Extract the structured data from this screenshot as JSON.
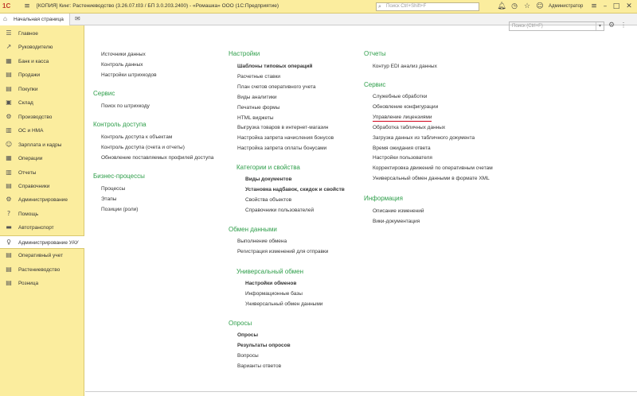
{
  "titlebar": {
    "title": "[КОПИЯ] Кинг: Растениеводство (3.26.07.t03 / БП 3.0.203.2400) - «Ромашка» ООО  (1С:Предприятие)",
    "search_placeholder": "Поиск Ctrl+Shift+F",
    "user": "Администратор",
    "logo": "1С"
  },
  "tabs": {
    "home_label": "Начальная страница"
  },
  "sidebar": {
    "items": [
      {
        "label": "Главное",
        "icon": "☰"
      },
      {
        "label": "Руководителю",
        "icon": "↗"
      },
      {
        "label": "Банк и касса",
        "icon": "▦"
      },
      {
        "label": "Продажи",
        "icon": "▤"
      },
      {
        "label": "Покупки",
        "icon": "▤"
      },
      {
        "label": "Склад",
        "icon": "▣"
      },
      {
        "label": "Производство",
        "icon": "⚙"
      },
      {
        "label": "ОС и НМА",
        "icon": "▥"
      },
      {
        "label": "Зарплата и кадры",
        "icon": "☺"
      },
      {
        "label": "Операции",
        "icon": "▦"
      },
      {
        "label": "Отчеты",
        "icon": "▥"
      },
      {
        "label": "Справочники",
        "icon": "▤"
      },
      {
        "label": "Администрирование",
        "icon": "⚙"
      },
      {
        "label": "Помощь",
        "icon": "?"
      },
      {
        "label": "Автотранспорт",
        "icon": "▬"
      },
      {
        "label": "Администрирование УАУ",
        "icon": "♀"
      },
      {
        "label": "Оперативный учет",
        "icon": "▤"
      },
      {
        "label": "Растениеводство",
        "icon": "▤"
      },
      {
        "label": "Розница",
        "icon": "▤"
      }
    ]
  },
  "main": {
    "search_placeholder": "Поиск (Ctrl+F)",
    "col1": {
      "top_links": [
        "Источники данных",
        "Контроль данных",
        "Настройки штрихкодов"
      ],
      "service_heading": "Сервис",
      "service_links": [
        "Поиск по штрихкоду"
      ],
      "access_heading": "Контроль доступа",
      "access_links": [
        "Контроль доступа к объектам",
        "Контроль доступа (счета и отчеты)",
        "Обновление поставляемых профилей доступа"
      ],
      "bp_heading": "Бизнес-процессы",
      "bp_links": [
        "Процессы",
        "Этапы",
        "Позиции (роли)"
      ]
    },
    "col2": {
      "settings_heading": "Настройки",
      "settings_links": [
        "Шаблоны типовых операций",
        "Расчетные ставки",
        "План счетов оперативного учета",
        "Виды аналитики",
        "Печатные формы",
        "HTML виджеты",
        "Выгрузка товаров в интернет-магазин",
        "Настройка запрета начисления бонусов",
        "Настройка запрета оплаты бонусами"
      ],
      "categories_heading": "Категории и свойства",
      "categories_links": [
        "Виды документов",
        "Установка надбавок, скидок и свойств",
        "Свойства объектов",
        "Справочники пользователей"
      ],
      "exchange_heading": "Обмен данными",
      "exchange_links": [
        "Выполнение обмена",
        "Регистрация изменений для отправки"
      ],
      "universal_heading": "Универсальный обмен",
      "universal_links": [
        "Настройки обменов",
        "Информационные базы",
        "Универсальный обмен данными"
      ],
      "polls_heading": "Опросы",
      "polls_links": [
        "Опросы",
        "Результаты опросов",
        "Вопросы",
        "Варианты ответов"
      ]
    },
    "col3": {
      "reports_heading": "Отчеты",
      "reports_links": [
        "Контур EDI анализ данных"
      ],
      "service_heading": "Сервис",
      "service_links": [
        "Служебные обработки",
        "Обновление конфигурации",
        "Управление лицензиями",
        "Обработка табличных данных",
        "Загрузка данных из табличного документа",
        "Время ожидания ответа",
        "Настройки пользователя",
        "Корректировка движений по оперативным счетам",
        "Универсальный обмен данными в формате XML"
      ],
      "info_heading": "Информация",
      "info_links": [
        "Описание изменений",
        "Вики-документация"
      ]
    }
  }
}
